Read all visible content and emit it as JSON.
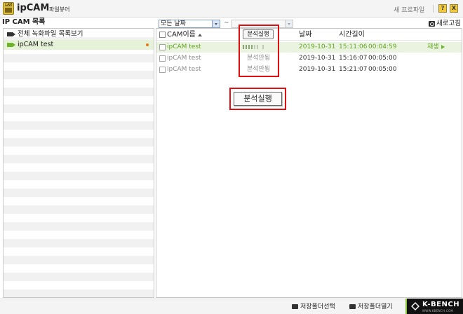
{
  "app": {
    "name": "ipCAM",
    "subtitle": "파일뷰어",
    "icon_label": "CAM",
    "profile_label": "새 프로파일",
    "help_label": "?",
    "close_label": "X"
  },
  "sidebar": {
    "header": "IP CAM 목록",
    "items": [
      {
        "label": "전체 녹화파일 목록보기",
        "icon": "video-camera-icon"
      },
      {
        "label": "ipCAM test",
        "icon": "video-camera-icon",
        "selected": true,
        "indicator": "orange-dot"
      }
    ]
  },
  "filter": {
    "date_start": "모든 날짜",
    "separator": "~",
    "date_end": ""
  },
  "toolbar": {
    "refresh_label": "새로고침"
  },
  "table": {
    "columns": {
      "name": "CAM이름",
      "analyze": "분석실행",
      "date": "날짜",
      "duration": "시간길이"
    },
    "rows": [
      {
        "name": "ipCAM test",
        "status": "",
        "progress": 0.3,
        "date": "2019-10-31",
        "start": "15:11:06",
        "duration": "00:04:59",
        "action": "재생",
        "selected": true
      },
      {
        "name": "ipCAM test",
        "status": "분석안됨",
        "date": "2019-10-31",
        "start": "15:16:07",
        "duration": "00:05:00"
      },
      {
        "name": "ipCAM test",
        "status": "분석안됨",
        "date": "2019-10-31",
        "start": "15:21:07",
        "duration": "00:05:00"
      }
    ]
  },
  "callout": {
    "label": "분석실행"
  },
  "bottom": {
    "select_folder": "저장폴더선택",
    "open_folder": "저장폴더열기",
    "watermark": "K-BENCH",
    "watermark_sub": "WWW.KBENCH.COM"
  },
  "colors": {
    "accent_green": "#5da51c",
    "highlight_red": "#e01010",
    "selected_row": "#eaf3df"
  }
}
